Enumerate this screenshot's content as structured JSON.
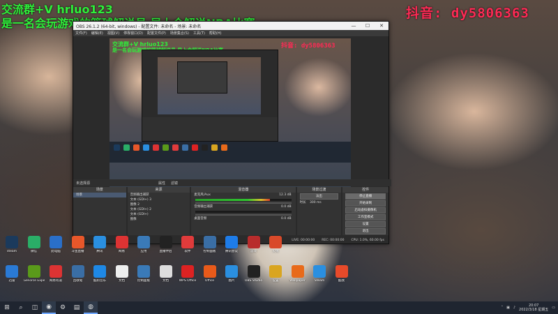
{
  "overlay": {
    "line1": "交流群+V hrluo123",
    "line2": "是一名会玩游戏的篮球解说员 早上会解说NBA比赛",
    "douyin": "抖音: dy5806363"
  },
  "obs": {
    "title": "OBS 26.1.2 (64-bit, windows) - 配置文件: 未命名 - 场景: 未命名",
    "menu": [
      "文件(F)",
      "编辑(E)",
      "视图(V)",
      "停靠窗口(D)",
      "配置文件(P)",
      "场景集合(S)",
      "工具(T)",
      "帮助(H)"
    ],
    "window_controls": {
      "minimize": "—",
      "maximize": "☐",
      "close": "✕"
    },
    "scene_bar": {
      "label": "未选择源",
      "properties": "属性",
      "filters": "滤镜"
    },
    "docks": {
      "scenes": {
        "title": "场景",
        "items": [
          "场景"
        ]
      },
      "sources": {
        "title": "来源",
        "items": [
          "音频输出捕获",
          "文本 (GDI+) 3",
          "图像 2",
          "文本 (GDI+) 2",
          "文本 (GDI+)",
          "图像"
        ]
      },
      "mixer": {
        "title": "混音器",
        "channels": [
          {
            "name": "麦克风/Aux",
            "level": "12.3 dB",
            "meter": 0.78
          },
          {
            "name": "音频输出捕获",
            "level": "0.0 dB",
            "meter": 0.0
          },
          {
            "name": "桌面音频",
            "level": "0.0 dB",
            "meter": 0.0
          }
        ]
      },
      "transitions": {
        "title": "场景过渡",
        "transition": "淡出",
        "duration_label": "时长",
        "duration": "300 ms"
      },
      "controls": {
        "title": "控件",
        "buttons": [
          "停止直播",
          "开始录制",
          "启动虚拟摄像机",
          "工作室模式",
          "设置",
          "退出"
        ]
      }
    },
    "status": {
      "live": "LIVE: 00:00:00",
      "rec": "REC: 00:00:00",
      "cpu": "CPU: 1.0%, 60.00 fps"
    },
    "preview_overlay": {
      "line1": "交流群+V hrluo123",
      "line2": "是一名会玩游戏的篮球解说员 早上会解说NBA比赛",
      "douyin": "抖音: dy5806363"
    }
  },
  "desktop_icons": [
    {
      "label": "steam",
      "icon": "steam-icon",
      "color": "#1b3a5c"
    },
    {
      "label": "微信",
      "icon": "wechat-icon",
      "color": "#2aae67"
    },
    {
      "label": "此电脑",
      "icon": "computer-icon",
      "color": "#2a6fc9"
    },
    {
      "label": "斗鱼直播",
      "icon": "douyu-icon",
      "color": "#e8572a"
    },
    {
      "label": "腾讯",
      "icon": "tencent-icon",
      "color": "#2a8fe0"
    },
    {
      "label": "网易",
      "icon": "netease-icon",
      "color": "#d33"
    },
    {
      "label": "应用",
      "icon": "app-icon",
      "color": "#3a7ab8"
    },
    {
      "label": "直播伴侣",
      "icon": "live-icon",
      "color": "#222"
    },
    {
      "label": "软件",
      "icon": "software-icon",
      "color": "#e03b3b"
    },
    {
      "label": "控制面板",
      "icon": "control-icon",
      "color": "#3a6ea5"
    },
    {
      "label": "腾讯会议",
      "icon": "meeting-icon",
      "color": "#1e7ce8"
    },
    {
      "label": "游戏",
      "icon": "game-icon",
      "color": "#b82c2c"
    },
    {
      "label": "火绒",
      "icon": "huorong-icon",
      "color": "#d94a2a"
    },
    {
      "label": "迅雷",
      "icon": "xunlei-icon",
      "color": "#2a7ad5"
    },
    {
      "label": "GeForce Experience",
      "icon": "nvidia-icon",
      "color": "#5a9a1a"
    },
    {
      "label": "网易有道",
      "icon": "youdao-icon",
      "color": "#d33"
    },
    {
      "label": "回收站",
      "icon": "recycle-icon",
      "color": "#3a6ea5"
    },
    {
      "label": "酷狗音乐",
      "icon": "kugou-icon",
      "color": "#1e88e5"
    },
    {
      "label": "文档",
      "icon": "document-icon",
      "color": "#eee"
    },
    {
      "label": "控制面板",
      "icon": "panel-icon",
      "color": "#3a7ab8"
    },
    {
      "label": "文档",
      "icon": "file-icon",
      "color": "#ddd"
    },
    {
      "label": "WPS Office",
      "icon": "wps-icon",
      "color": "#d22"
    },
    {
      "label": "Office",
      "icon": "office-icon",
      "color": "#e85a1a"
    },
    {
      "label": "图片",
      "icon": "pictures-icon",
      "color": "#2a8fe0"
    },
    {
      "label": "OBS Studio",
      "icon": "obs-icon",
      "color": "#222"
    },
    {
      "label": "设置",
      "icon": "settings-icon",
      "color": "#d9a520"
    },
    {
      "label": "Wallpaper",
      "icon": "wallpaper-icon",
      "color": "#e86a1a"
    },
    {
      "label": "Steam",
      "icon": "steam2-icon",
      "color": "#2a8fe0"
    },
    {
      "label": "酷我",
      "icon": "kuwo-icon",
      "color": "#e84a2a"
    }
  ],
  "taskbar": {
    "items": [
      "windows-icon",
      "search-icon",
      "taskview-icon",
      "obs-icon",
      "steam-icon",
      "explorer-icon",
      "browser-icon"
    ],
    "time": "20:07",
    "date": "2022/3/18 星期五"
  }
}
